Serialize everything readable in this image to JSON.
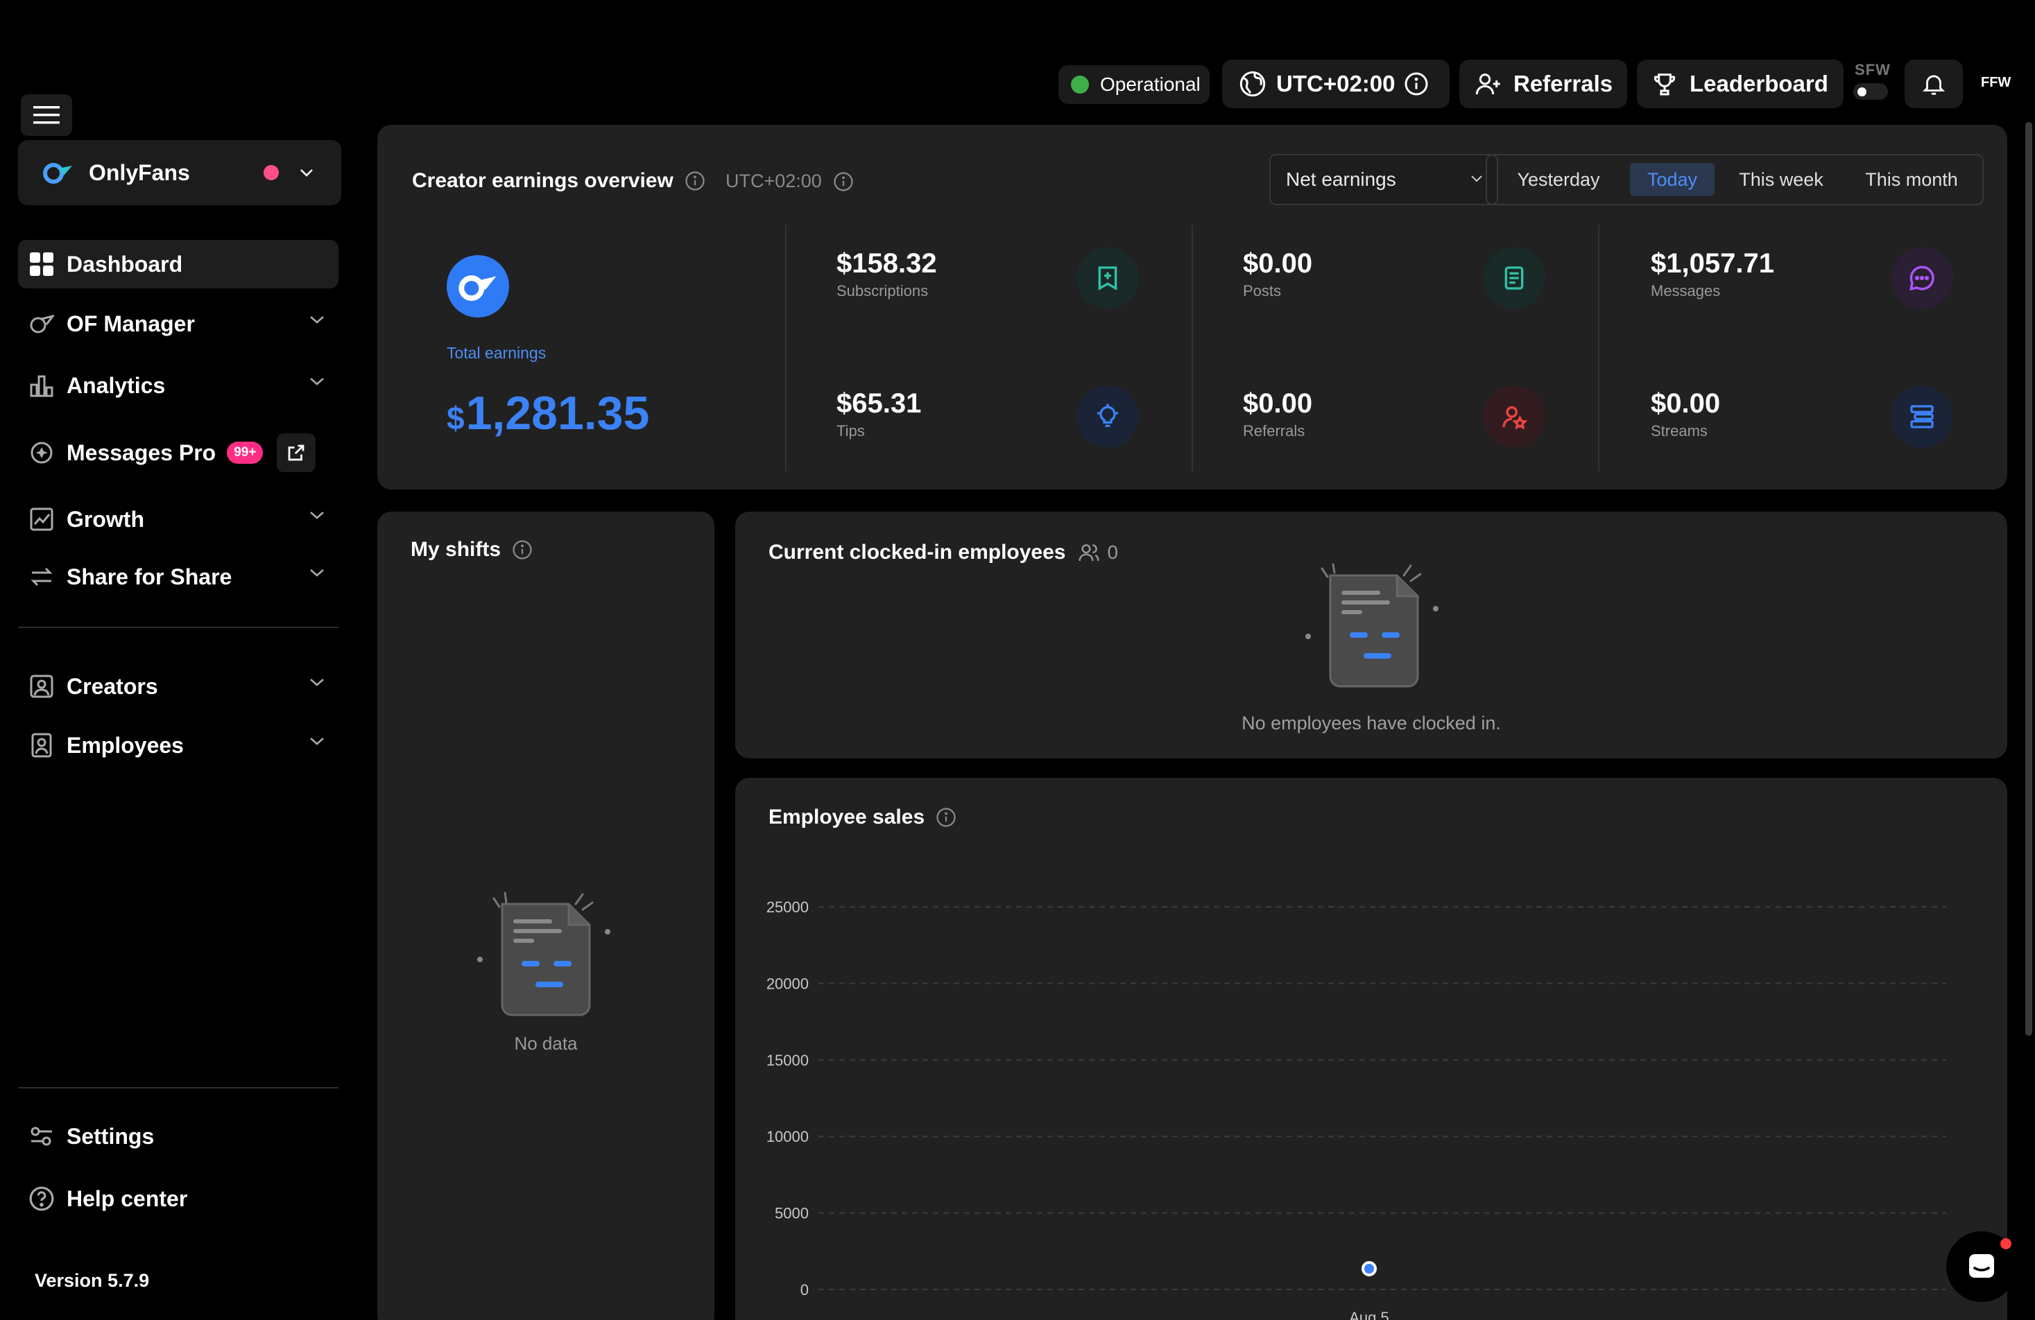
{
  "topbar": {
    "status": "Operational",
    "timezone": "UTC+02:00",
    "referrals": "Referrals",
    "leaderboard": "Leaderboard",
    "sfw": "SFW",
    "ffw": "FFW"
  },
  "sidebar": {
    "account": "OnlyFans",
    "items": [
      {
        "label": "Dashboard",
        "icon": "grid-icon"
      },
      {
        "label": "OF Manager",
        "icon": "of-manager-icon"
      },
      {
        "label": "Analytics",
        "icon": "bar-chart-icon"
      },
      {
        "label": "Messages Pro",
        "icon": "messages-pro-icon",
        "badge": "99+"
      },
      {
        "label": "Growth",
        "icon": "growth-icon"
      },
      {
        "label": "Share for Share",
        "icon": "swap-icon"
      },
      {
        "label": "Creators",
        "icon": "creator-icon"
      },
      {
        "label": "Employees",
        "icon": "badge-icon"
      }
    ],
    "settings": "Settings",
    "help": "Help center",
    "version": "Version 5.7.9"
  },
  "overview": {
    "title": "Creator earnings overview",
    "timezone": "UTC+02:00",
    "metric": "Net earnings",
    "periods": [
      "Yesterday",
      "Today",
      "This week",
      "This month"
    ],
    "active_period": "Today",
    "total_label": "Total earnings",
    "total_currency": "$",
    "total_value": "1,281.35",
    "stats": [
      {
        "value": "$158.32",
        "label": "Subscriptions",
        "color": "#2ec4a7"
      },
      {
        "value": "$0.00",
        "label": "Posts",
        "color": "#2ec4a7"
      },
      {
        "value": "$1,057.71",
        "label": "Messages",
        "color": "#a855f7"
      },
      {
        "value": "$65.31",
        "label": "Tips",
        "color": "#3b82f6"
      },
      {
        "value": "$0.00",
        "label": "Referrals",
        "color": "#ef4444"
      },
      {
        "value": "$0.00",
        "label": "Streams",
        "color": "#3b82f6"
      }
    ]
  },
  "shifts": {
    "title": "My shifts",
    "empty": "No data"
  },
  "clocked": {
    "title": "Current clocked-in employees",
    "count": "0",
    "empty": "No employees have clocked in."
  },
  "sales": {
    "title": "Employee sales"
  },
  "chart_data": {
    "type": "scatter",
    "title": "Employee sales",
    "x": [
      "Aug 5"
    ],
    "series": [
      {
        "values": [
          0
        ]
      }
    ],
    "y_ticks": [
      0,
      5000,
      10000,
      15000,
      20000,
      25000
    ],
    "ylim": [
      0,
      25000
    ],
    "grid": true,
    "grid_style": "dashed",
    "point_color": "#3b82f6"
  }
}
